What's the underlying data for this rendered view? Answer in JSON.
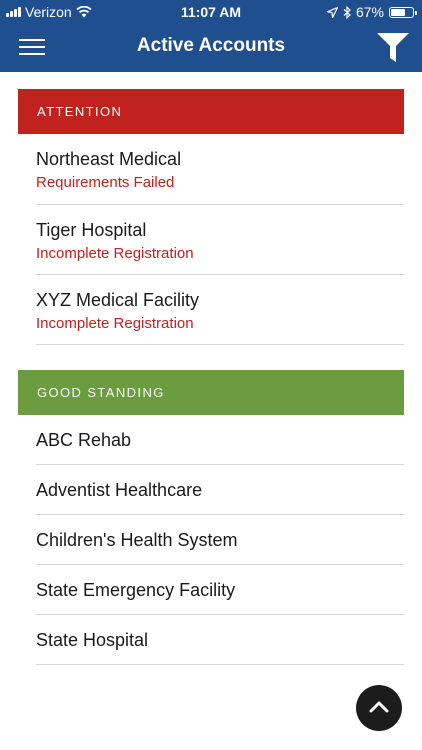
{
  "status": {
    "carrier": "Verizon",
    "time": "11:07 AM",
    "battery": "67%",
    "battery_level": 0.67
  },
  "navbar": {
    "title": "Active Accounts"
  },
  "attention": {
    "label": "ATTENTION",
    "color": "#c0231f",
    "items": [
      {
        "name": "Northeast Medical",
        "status": "Requirements Failed"
      },
      {
        "name": "Tiger Hospital",
        "status": "Incomplete Registration"
      },
      {
        "name": "XYZ Medical Facility",
        "status": "Incomplete Registration"
      }
    ]
  },
  "good_standing": {
    "label": "GOOD STANDING",
    "color": "#6b9c40",
    "items": [
      {
        "name": "ABC Rehab"
      },
      {
        "name": "Adventist Healthcare"
      },
      {
        "name": "Children's Health System"
      },
      {
        "name": "State Emergency Facility"
      },
      {
        "name": "State Hospital"
      }
    ]
  },
  "colors": {
    "header": "#1f4f8f"
  },
  "icons": {
    "menu": "hamburger-menu-icon",
    "filter": "filter-funnel-icon",
    "scroll_top": "chevron-up-icon"
  }
}
